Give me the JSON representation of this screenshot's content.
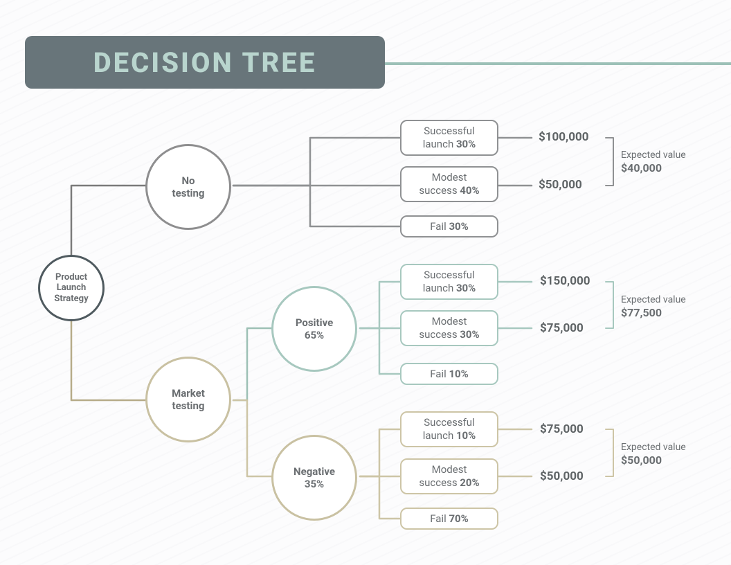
{
  "title": "DECISION TREE",
  "root": {
    "label_l1": "Product",
    "label_l2": "Launch",
    "label_l3": "Strategy"
  },
  "no_testing": {
    "label_l1": "No",
    "label_l2": "testing"
  },
  "market_testing": {
    "label_l1": "Market",
    "label_l2": "testing"
  },
  "positive": {
    "label": "Positive",
    "pct": "65%"
  },
  "negative": {
    "label": "Negative",
    "pct": "35%"
  },
  "nt": {
    "succ_l1": "Successful",
    "succ_l2": "launch ",
    "succ_pct": "30%",
    "mod_l1": "Modest",
    "mod_l2": "success ",
    "mod_pct": "40%",
    "fail_l": "Fail ",
    "fail_pct": "30%",
    "v1": "$100,000",
    "v2": "$50,000",
    "ev_label": "Expected value",
    "ev": "$40,000"
  },
  "pos": {
    "succ_l1": "Successful",
    "succ_l2": "launch ",
    "succ_pct": "30%",
    "mod_l1": "Modest",
    "mod_l2": "success ",
    "mod_pct": "30%",
    "fail_l": "Fail ",
    "fail_pct": "10%",
    "v1": "$150,000",
    "v2": "$75,000",
    "ev_label": "Expected value",
    "ev": "$77,500"
  },
  "neg": {
    "succ_l1": "Successful",
    "succ_l2": "launch ",
    "succ_pct": "10%",
    "mod_l1": "Modest",
    "mod_l2": "success ",
    "mod_pct": "20%",
    "fail_l": "Fail ",
    "fail_pct": "70%",
    "v1": "$75,000",
    "v2": "$50,000",
    "ev_label": "Expected value",
    "ev": "$50,000"
  }
}
